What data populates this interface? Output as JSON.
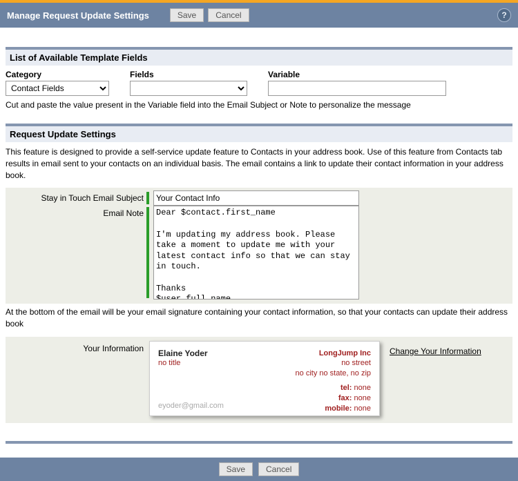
{
  "header": {
    "title": "Manage Request Update Settings",
    "save": "Save",
    "cancel": "Cancel"
  },
  "templateFields": {
    "heading": "List of Available Template Fields",
    "categoryLabel": "Category",
    "categoryValue": "Contact Fields",
    "fieldsLabel": "Fields",
    "fieldsValue": "",
    "variableLabel": "Variable",
    "variableValue": "",
    "hint": "Cut and paste the value present in the Variable field into the Email Subject or Note to personalize the message"
  },
  "requestUpdate": {
    "heading": "Request Update Settings",
    "description": "This feature is designed to provide a self-service update feature to Contacts in your address book. Use of this feature from Contacts tab results in email sent to your contacts on an individual basis. The email contains a link to update their contact information in your address book.",
    "subjectLabel": "Stay in Touch Email Subject",
    "subjectValue": "Your Contact Info",
    "noteLabel": "Email Note",
    "noteValue": "Dear $contact.first_name\n\nI'm updating my address book. Please take a moment to update me with your latest contact info so that we can stay in touch.\n\nThanks\n$user.full_name",
    "signatureHint": "At the bottom of the email will be your email signature containing your contact information, so that your contacts can update their address book",
    "yourInfoLabel": "Your Information",
    "card": {
      "name": "Elaine Yoder",
      "title": "no title",
      "company": "LongJump Inc",
      "street": "no street",
      "cityStateZip": "no city no state, no zip",
      "telLabel": "tel:",
      "telValue": "none",
      "faxLabel": "fax:",
      "faxValue": "none",
      "mobileLabel": "mobile:",
      "mobileValue": "none",
      "email": "eyoder@gmail.com"
    },
    "changeLink": "Change Your Information"
  },
  "footer": {
    "save": "Save",
    "cancel": "Cancel"
  }
}
